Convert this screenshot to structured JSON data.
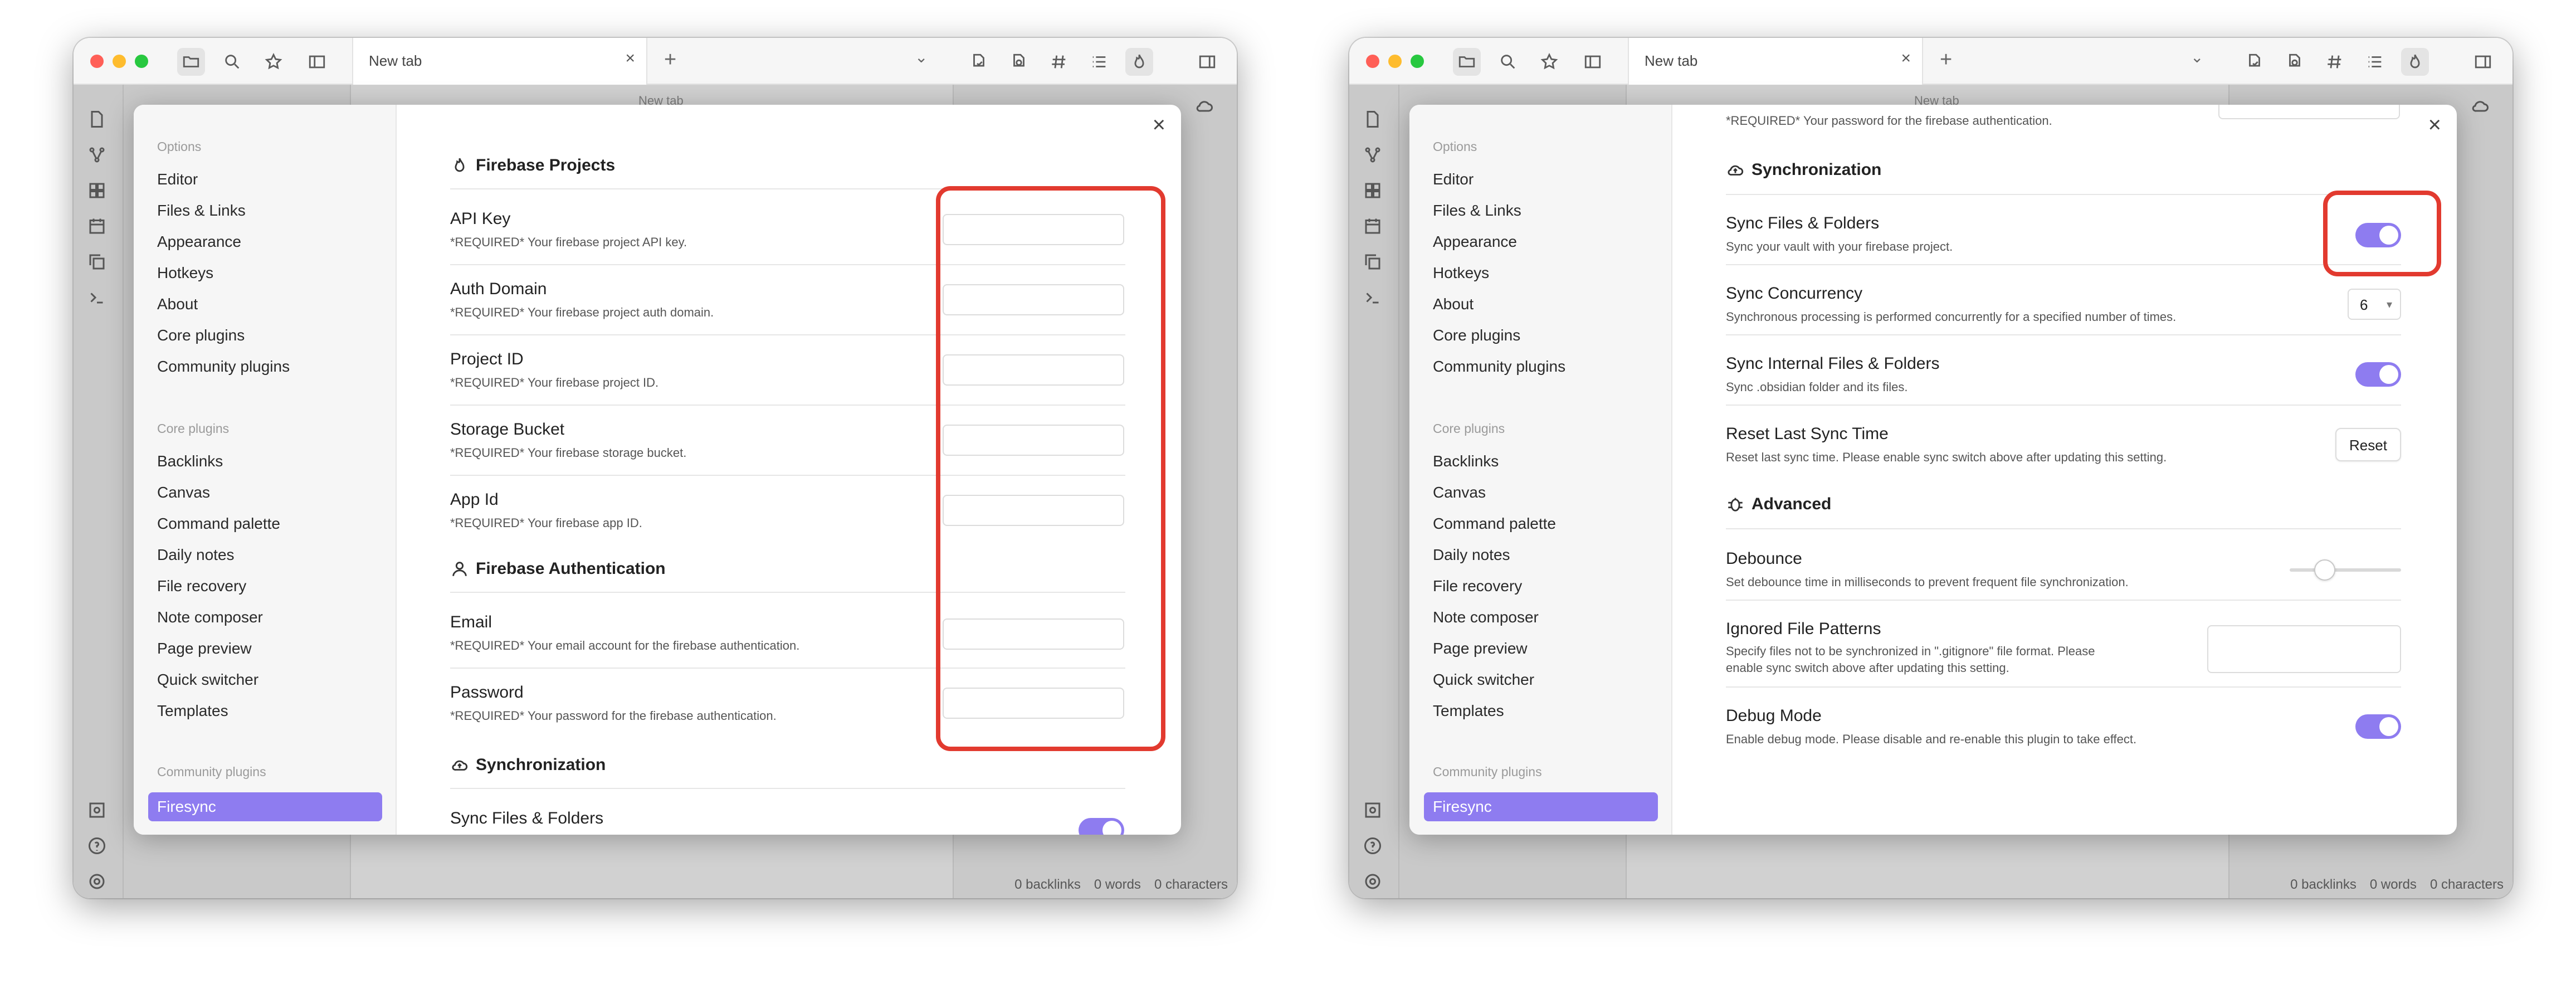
{
  "colors": {
    "accent": "#8e7cf0",
    "highlight": "#e23a2f",
    "traffic_red": "#ff5f57",
    "traffic_yellow": "#febc2e",
    "traffic_green": "#28c840"
  },
  "icons": {
    "topbar": [
      "folder-icon",
      "search-icon",
      "star-icon",
      "sidebar-icon"
    ],
    "right_topbar": [
      "file-sync-icon",
      "file-link-icon",
      "hash-icon",
      "list-icon",
      "flame-icon",
      "right-sidebar-icon"
    ],
    "ribbon": [
      "file-icon",
      "graph-icon",
      "grid-icon",
      "calendar-icon",
      "copy-icon",
      "terminal-icon",
      "vault-icon",
      "help-icon",
      "settings-icon"
    ],
    "cloud": "cloud-icon"
  },
  "window": {
    "tab_title": "New tab",
    "tab_close": "×",
    "tab_add": "+",
    "tab_chevron": "⌄",
    "bg_title": "New tab",
    "status": {
      "backlinks": "0 backlinks",
      "words": "0 words",
      "characters": "0 characters"
    }
  },
  "modal": {
    "close": "×",
    "sidebar": {
      "options_label": "Options",
      "options": [
        "Editor",
        "Files & Links",
        "Appearance",
        "Hotkeys",
        "About",
        "Core plugins",
        "Community plugins"
      ],
      "core_label": "Core plugins",
      "core": [
        "Backlinks",
        "Canvas",
        "Command palette",
        "Daily notes",
        "File recovery",
        "Note composer",
        "Page preview",
        "Quick switcher",
        "Templates"
      ],
      "community_label": "Community plugins",
      "community_active": "Firesync"
    }
  },
  "left": {
    "firebase_projects": "Firebase Projects",
    "api_key": {
      "name": "API Key",
      "desc": "*REQUIRED* Your firebase project API key."
    },
    "auth_domain": {
      "name": "Auth Domain",
      "desc": "*REQUIRED* Your firebase project auth domain."
    },
    "project_id": {
      "name": "Project ID",
      "desc": "*REQUIRED* Your firebase project ID."
    },
    "storage_bucket": {
      "name": "Storage Bucket",
      "desc": "*REQUIRED* Your firebase storage bucket."
    },
    "app_id": {
      "name": "App Id",
      "desc": "*REQUIRED* Your firebase app ID."
    },
    "firebase_auth": "Firebase Authentication",
    "email": {
      "name": "Email",
      "desc": "*REQUIRED* Your email account for the firebase authentication."
    },
    "password": {
      "name": "Password",
      "desc": "*REQUIRED* Your password for the firebase authentication."
    },
    "synchronization": "Synchronization",
    "sync_files": "Sync Files & Folders"
  },
  "right": {
    "password_desc": "*REQUIRED* Your password for the firebase authentication.",
    "synchronization": "Synchronization",
    "sync_files": {
      "name": "Sync Files & Folders",
      "desc": "Sync your vault with your firebase project."
    },
    "sync_concurrency": {
      "name": "Sync Concurrency",
      "desc": "Synchronous processing is performed concurrently for a specified number of times.",
      "value": "6"
    },
    "sync_internal": {
      "name": "Sync Internal Files & Folders",
      "desc": "Sync .obsidian folder and its files."
    },
    "reset_last": {
      "name": "Reset Last Sync Time",
      "desc": "Reset last sync time. Please enable sync switch above after updating this setting.",
      "button": "Reset"
    },
    "advanced": "Advanced",
    "debounce": {
      "name": "Debounce",
      "desc": "Set debounce time in milliseconds to prevent frequent file synchronization."
    },
    "ignored": {
      "name": "Ignored File Patterns",
      "desc1": "Specify files not to be synchronized in \".gitignore\" file format. Please",
      "desc2": "enable sync switch above after updating this setting."
    },
    "debug": {
      "name": "Debug Mode",
      "desc": "Enable debug mode. Please disable and re-enable this plugin to take effect."
    }
  }
}
